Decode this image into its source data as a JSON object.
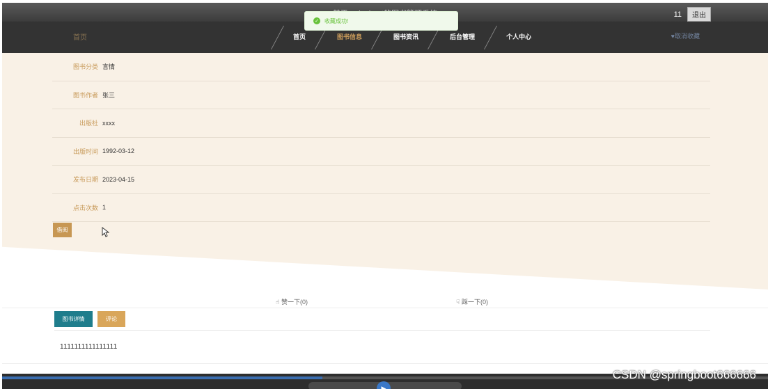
{
  "header": {
    "site_title": "基于springboot的图书管理系统",
    "user_name": "11",
    "logout_label": "退出"
  },
  "nav": {
    "brand": "首页",
    "items": [
      {
        "label": "首页"
      },
      {
        "label": "图书信息"
      },
      {
        "label": "图书资讯"
      },
      {
        "label": "后台管理"
      },
      {
        "label": "个人中心"
      }
    ],
    "active_index": 1,
    "right_action": "♥取消收藏"
  },
  "toast": {
    "text": "收藏成功!",
    "color": "#67c23a"
  },
  "book_detail": {
    "rows": [
      {
        "label": "图书分类",
        "value": "言情"
      },
      {
        "label": "图书作者",
        "value": "张三"
      },
      {
        "label": "出版社",
        "value": "xxxx"
      },
      {
        "label": "出版时间",
        "value": "1992-03-12"
      },
      {
        "label": "发布日期",
        "value": "2023-04-15"
      },
      {
        "label": "点击次数",
        "value": "1"
      }
    ],
    "borrow_label": "借阅"
  },
  "votes": {
    "like_label": "赞一下(0)",
    "dislike_label": "踩一下(0)"
  },
  "tabs": {
    "detail_label": "图书详情",
    "comment_label": "评论"
  },
  "content": {
    "detail_text": "1111111111111111"
  },
  "watermark": "CSDN @springboot666666",
  "colors": {
    "accent": "#c89a5a",
    "tab_active": "#1f7d8c",
    "detail_bg": "#f9f1e6"
  }
}
